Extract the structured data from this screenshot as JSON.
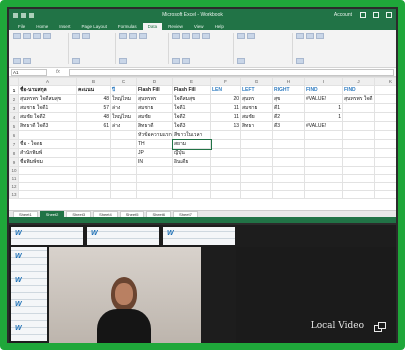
{
  "excel": {
    "title": "Microsoft Excel - Workbook",
    "user": "Account",
    "tabs": [
      "File",
      "Home",
      "Insert",
      "Page Layout",
      "Formulas",
      "Data",
      "Review",
      "View",
      "Help"
    ],
    "active_tab": "Data",
    "namebox": "A1",
    "fx": "fx",
    "columns": [
      "",
      "A",
      "B",
      "C",
      "D",
      "E",
      "F",
      "G",
      "H",
      "I",
      "J",
      "K"
    ],
    "header_row": [
      "ชื่อ-นามสกุล",
      "คะแนน",
      "ปี",
      "Flash Fill",
      "Flash Fill",
      "LEN",
      "LEFT",
      "RIGHT",
      "FIND",
      "FIND"
    ],
    "rows": [
      [
        "สุนทรพร ใจดีสมสุข",
        "48",
        "ใหญ่ไหม",
        "สุนทรพร",
        "ใจดีสมสุข",
        "20",
        "สุนทร",
        "สุข",
        "#VALUE!",
        "สุนทรพร ใจดี"
      ],
      [
        "สมชาย ใจดี1",
        "57",
        "ล่าง",
        "สมชาย",
        "ใจดี1",
        "11",
        "สมชาย",
        "ดี1",
        "1",
        ""
      ],
      [
        "สมชัย ใจดี2",
        "48",
        "ใหญ่ไหม",
        "สมชัย",
        "ใจดี2",
        "11",
        "สมชัย",
        "ดี2",
        "1",
        ""
      ],
      [
        "สิทธาดี ใจดี3",
        "61",
        "ล่าง",
        "สิทธาดี",
        "ใจดี3",
        "13",
        "สิทธา",
        "ดี3",
        "#VALUE!",
        ""
      ]
    ],
    "second_block": {
      "labels": [
        "ชื่อ - ใจดย",
        "สำนักพิมพ์",
        "ชื่อพิมพ์ชม"
      ],
      "col_d": [
        "หัวข้อความแรก",
        "TH",
        "JP",
        "IN"
      ],
      "col_e": [
        "สีขาวในเวลา",
        "สยาม",
        "ญี่ปุ่น",
        "อินเดีย"
      ]
    },
    "sheet_tabs": [
      "Sheet1",
      "Sheet2",
      "Sheet3",
      "Sheet4",
      "Sheet5",
      "Sheet6",
      "Sheet7"
    ]
  },
  "video": {
    "local_label": "Local Video",
    "tile_mark": "W"
  },
  "colors": {
    "frame": "#1fa73a",
    "excel_green": "#217346",
    "header_blue": "#2f7cc1"
  }
}
